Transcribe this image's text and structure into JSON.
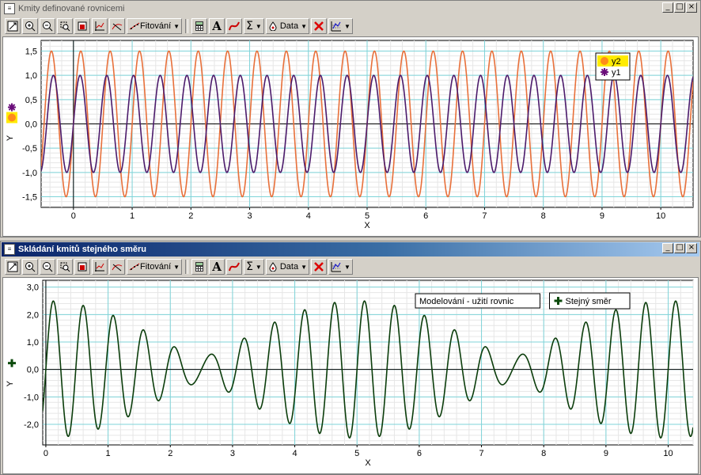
{
  "windows": [
    {
      "id": "top",
      "title": "Kmity definované rovnicemi",
      "active": false,
      "toolbar": {
        "fit_label": "Fitování",
        "data_label": "Data"
      }
    },
    {
      "id": "bottom",
      "title": "Skládání kmitů stejného směru",
      "active": true,
      "toolbar": {
        "fit_label": "Fitování",
        "data_label": "Data"
      }
    }
  ],
  "charts": [
    {
      "type": "line",
      "xlabel": "X",
      "ylabel": "Y",
      "xlim": [
        -0.55,
        10.55
      ],
      "ylim": [
        -1.72,
        1.72
      ],
      "xticks": [
        0,
        1,
        2,
        3,
        4,
        5,
        6,
        7,
        8,
        9,
        10
      ],
      "yticks": [
        -1.5,
        -1.0,
        -0.5,
        0.0,
        0.5,
        1.0,
        1.5
      ],
      "ytick_labels": [
        "-1,5",
        "-1,0",
        "-0,5",
        "0,0",
        "0,5",
        "1,0",
        "1,5"
      ],
      "grid": true,
      "legend_position": "top-right",
      "legend": [
        {
          "name": "y2",
          "marker": "circle",
          "color": "#ff8c1a",
          "highlight": true
        },
        {
          "name": "y1",
          "marker": "asterisk",
          "color": "#6a0d7a",
          "highlight": false
        }
      ],
      "series": [
        {
          "name": "y2",
          "color": "#e8703a",
          "amplitude": 1.5,
          "frequency": 2.0,
          "phase": 0.0
        },
        {
          "name": "y1",
          "color": "#4b1a6b",
          "amplitude": 1.0,
          "frequency": 2.2,
          "phase": 0.0
        }
      ]
    },
    {
      "type": "line",
      "xlabel": "X",
      "ylabel": "Y",
      "xlim": [
        -0.05,
        10.4
      ],
      "ylim": [
        -2.75,
        3.25
      ],
      "xticks": [
        0,
        1,
        2,
        3,
        4,
        5,
        6,
        7,
        8,
        9,
        10
      ],
      "yticks": [
        -2.0,
        -1.0,
        0.0,
        1.0,
        2.0,
        3.0
      ],
      "ytick_labels": [
        "-2,0",
        "-1,0",
        "0,0",
        "1,0",
        "2,0",
        "3,0"
      ],
      "grid": true,
      "annotation": "Modelování - užití rovnic",
      "legend_position": "top-right",
      "legend": [
        {
          "name": "Stejný směr",
          "marker": "plus",
          "color": "#0b4a0b",
          "highlight": false
        }
      ],
      "series": [
        {
          "name": "Stejný směr",
          "color": "#0b3d0b",
          "components": [
            {
              "amplitude": 1.5,
              "frequency": 2.0
            },
            {
              "amplitude": 1.0,
              "frequency": 2.2
            }
          ]
        }
      ]
    }
  ]
}
